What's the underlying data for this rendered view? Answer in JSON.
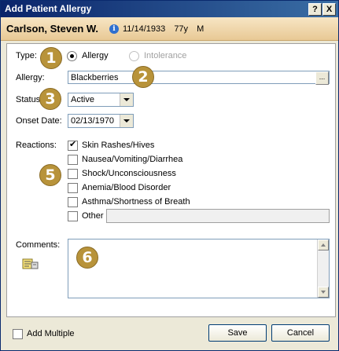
{
  "window": {
    "title": "Add Patient Allergy",
    "help_label": "?",
    "close_label": "X"
  },
  "patient": {
    "name": "Carlson, Steven W.",
    "info_icon": "i",
    "dob": "11/14/1933",
    "age": "77y",
    "sex": "M"
  },
  "form": {
    "type_label": "Type:",
    "type_options": [
      {
        "label": "Allergy",
        "selected": true
      },
      {
        "label": "Intolerance",
        "selected": false
      }
    ],
    "allergy_label": "Allergy:",
    "allergy_value": "Blackberries",
    "allergy_browse_label": "...",
    "status_label": "Status:",
    "status_value": "Active",
    "onset_label": "Onset Date:",
    "onset_value": "02/13/1970",
    "reactions_label": "Reactions:",
    "reactions": [
      {
        "label": "Skin Rashes/Hives",
        "checked": true
      },
      {
        "label": "Nausea/Vomiting/Diarrhea",
        "checked": false
      },
      {
        "label": "Shock/Unconsciousness",
        "checked": false
      },
      {
        "label": "Anemia/Blood Disorder",
        "checked": false
      },
      {
        "label": "Asthma/Shortness of Breath",
        "checked": false
      },
      {
        "label": "Other",
        "checked": false
      }
    ],
    "other_value": "",
    "comments_label": "Comments:",
    "comments_value": ""
  },
  "markers": [
    "1",
    "2",
    "3",
    "5",
    "6"
  ],
  "footer": {
    "add_multiple_label": "Add Multiple",
    "add_multiple_checked": false,
    "save_label": "Save",
    "cancel_label": "Cancel"
  }
}
